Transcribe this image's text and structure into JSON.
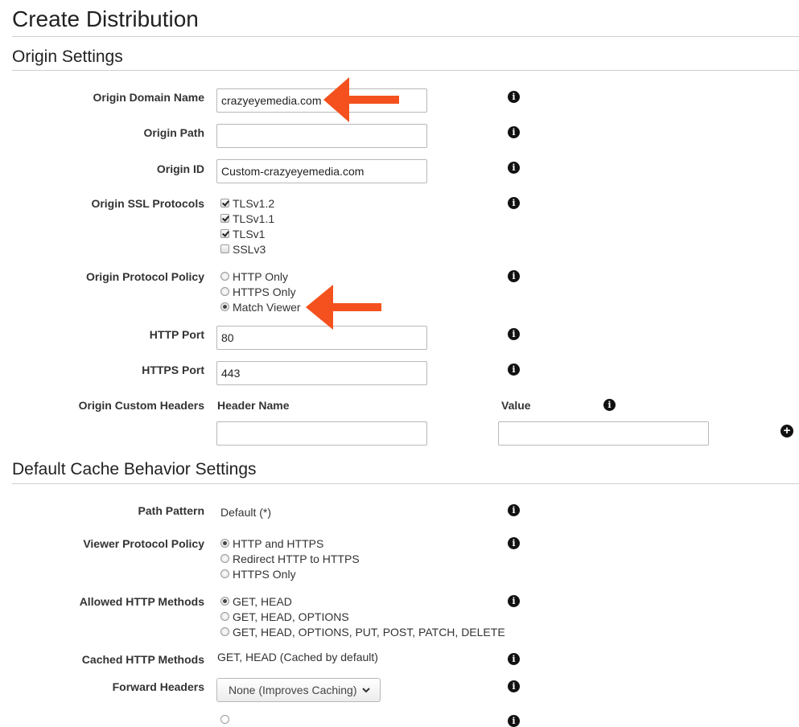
{
  "page": {
    "title": "Create Distribution"
  },
  "origin_settings": {
    "title": "Origin Settings",
    "domain_name": {
      "label": "Origin Domain Name",
      "value": "crazyeyemedia.com"
    },
    "path": {
      "label": "Origin Path",
      "value": ""
    },
    "id": {
      "label": "Origin ID",
      "value": "Custom-crazyeyemedia.com"
    },
    "ssl_protocols": {
      "label": "Origin SSL Protocols",
      "options": [
        {
          "label": "TLSv1.2",
          "checked": true
        },
        {
          "label": "TLSv1.1",
          "checked": true
        },
        {
          "label": "TLSv1",
          "checked": true
        },
        {
          "label": "SSLv3",
          "checked": false
        }
      ]
    },
    "protocol_policy": {
      "label": "Origin Protocol Policy",
      "options": [
        {
          "label": "HTTP Only",
          "selected": false
        },
        {
          "label": "HTTPS Only",
          "selected": false
        },
        {
          "label": "Match Viewer",
          "selected": true
        }
      ]
    },
    "http_port": {
      "label": "HTTP Port",
      "value": "80"
    },
    "https_port": {
      "label": "HTTPS Port",
      "value": "443"
    },
    "custom_headers": {
      "label": "Origin Custom Headers",
      "header_name": "Header Name",
      "value_header": "Value",
      "name_value": "",
      "value_value": ""
    }
  },
  "cache_behavior": {
    "title": "Default Cache Behavior Settings",
    "path_pattern": {
      "label": "Path Pattern",
      "value": "Default (*)"
    },
    "viewer_protocol": {
      "label": "Viewer Protocol Policy",
      "options": [
        {
          "label": "HTTP and HTTPS",
          "selected": true
        },
        {
          "label": "Redirect HTTP to HTTPS",
          "selected": false
        },
        {
          "label": "HTTPS Only",
          "selected": false
        }
      ]
    },
    "allowed_methods": {
      "label": "Allowed HTTP Methods",
      "options": [
        {
          "label": "GET, HEAD",
          "selected": true
        },
        {
          "label": "GET, HEAD, OPTIONS",
          "selected": false
        },
        {
          "label": "GET, HEAD, OPTIONS, PUT, POST, PATCH, DELETE",
          "selected": false
        }
      ]
    },
    "cached_methods": {
      "label": "Cached HTTP Methods",
      "value": "GET, HEAD (Cached by default)"
    },
    "forward_headers": {
      "label": "Forward Headers",
      "value": "None (Improves Caching)"
    }
  },
  "icons": {
    "info": "i",
    "plus": "+"
  },
  "colors": {
    "annotation_arrow": "#f4511e",
    "text": "#333333",
    "rule": "#cfcfcf"
  }
}
